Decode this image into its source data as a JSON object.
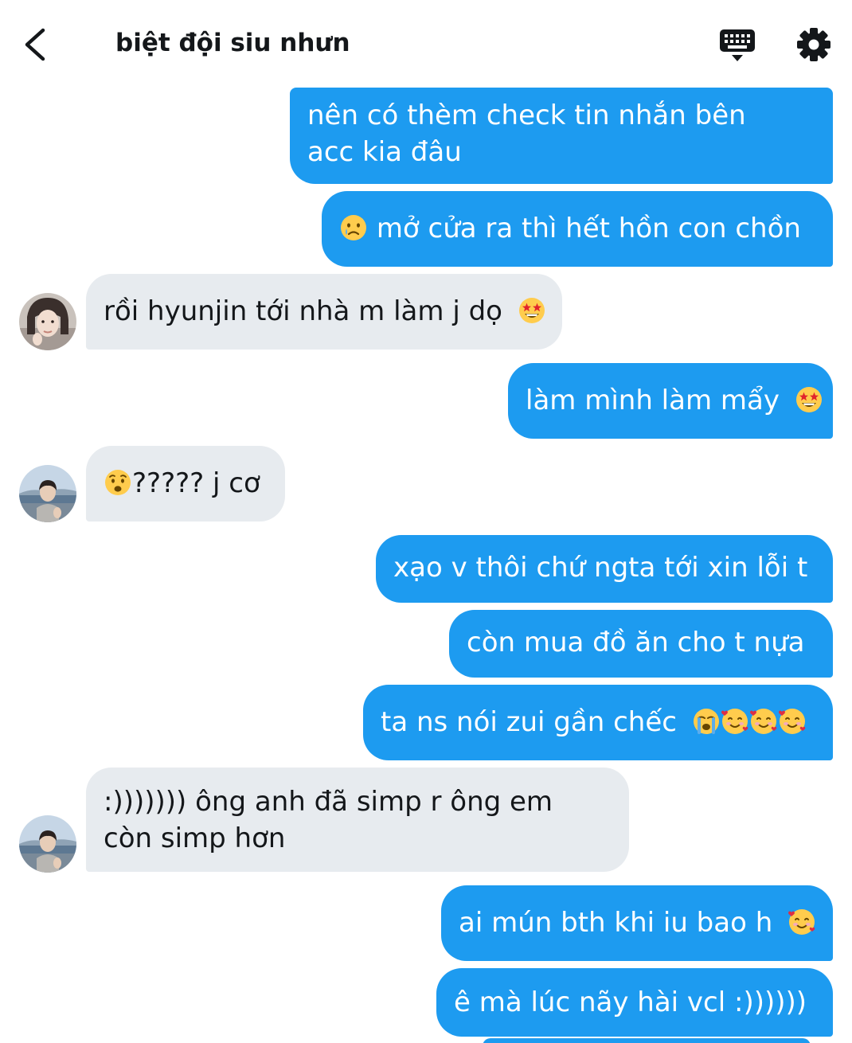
{
  "header": {
    "title": "biệt đội siu nhưn"
  },
  "colors": {
    "sent_bubble": "#1d9bf0",
    "received_bubble": "#e7ebef",
    "text_dark": "#14171a"
  },
  "icons": {
    "back": "chevron-left-icon",
    "keyboard": "keyboard-icon",
    "settings": "gear-icon"
  },
  "messages": [
    {
      "sender": "me",
      "lines": [
        "nên có thèm check tin nhắn bên",
        "acc kia đâu"
      ]
    },
    {
      "sender": "me",
      "emoji_before": "crying-face",
      "text": "mở cửa ra thì hết hồn con chồn"
    },
    {
      "sender": "other",
      "text": "rồi hyunjin tới nhà m làm j dọ",
      "emoji_after": "star-struck"
    },
    {
      "sender": "me",
      "text": "làm mình làm mẩy",
      "emoji_after": "star-struck"
    },
    {
      "sender": "other",
      "emoji_before": "anguished-face",
      "text": "????? j cơ"
    },
    {
      "sender": "me",
      "text": "xạo v thôi chứ ngta tới xin lỗi t"
    },
    {
      "sender": "me",
      "text": "còn mua đồ ăn cho t nựa"
    },
    {
      "sender": "me",
      "text": "ta ns nói zui gần chếc",
      "emojis_after": [
        "loudly-crying",
        "smiling-hearts",
        "smiling-hearts",
        "smiling-hearts"
      ]
    },
    {
      "sender": "other",
      "lines": [
        ":))))))) ông anh đã simp r ông em",
        "còn simp hơn"
      ]
    },
    {
      "sender": "me",
      "text": "ai mún bth khi iu bao h",
      "emoji_after": "smiling-hearts"
    },
    {
      "sender": "me",
      "text": "ê mà lúc nãy hài vcl :))))))"
    }
  ]
}
